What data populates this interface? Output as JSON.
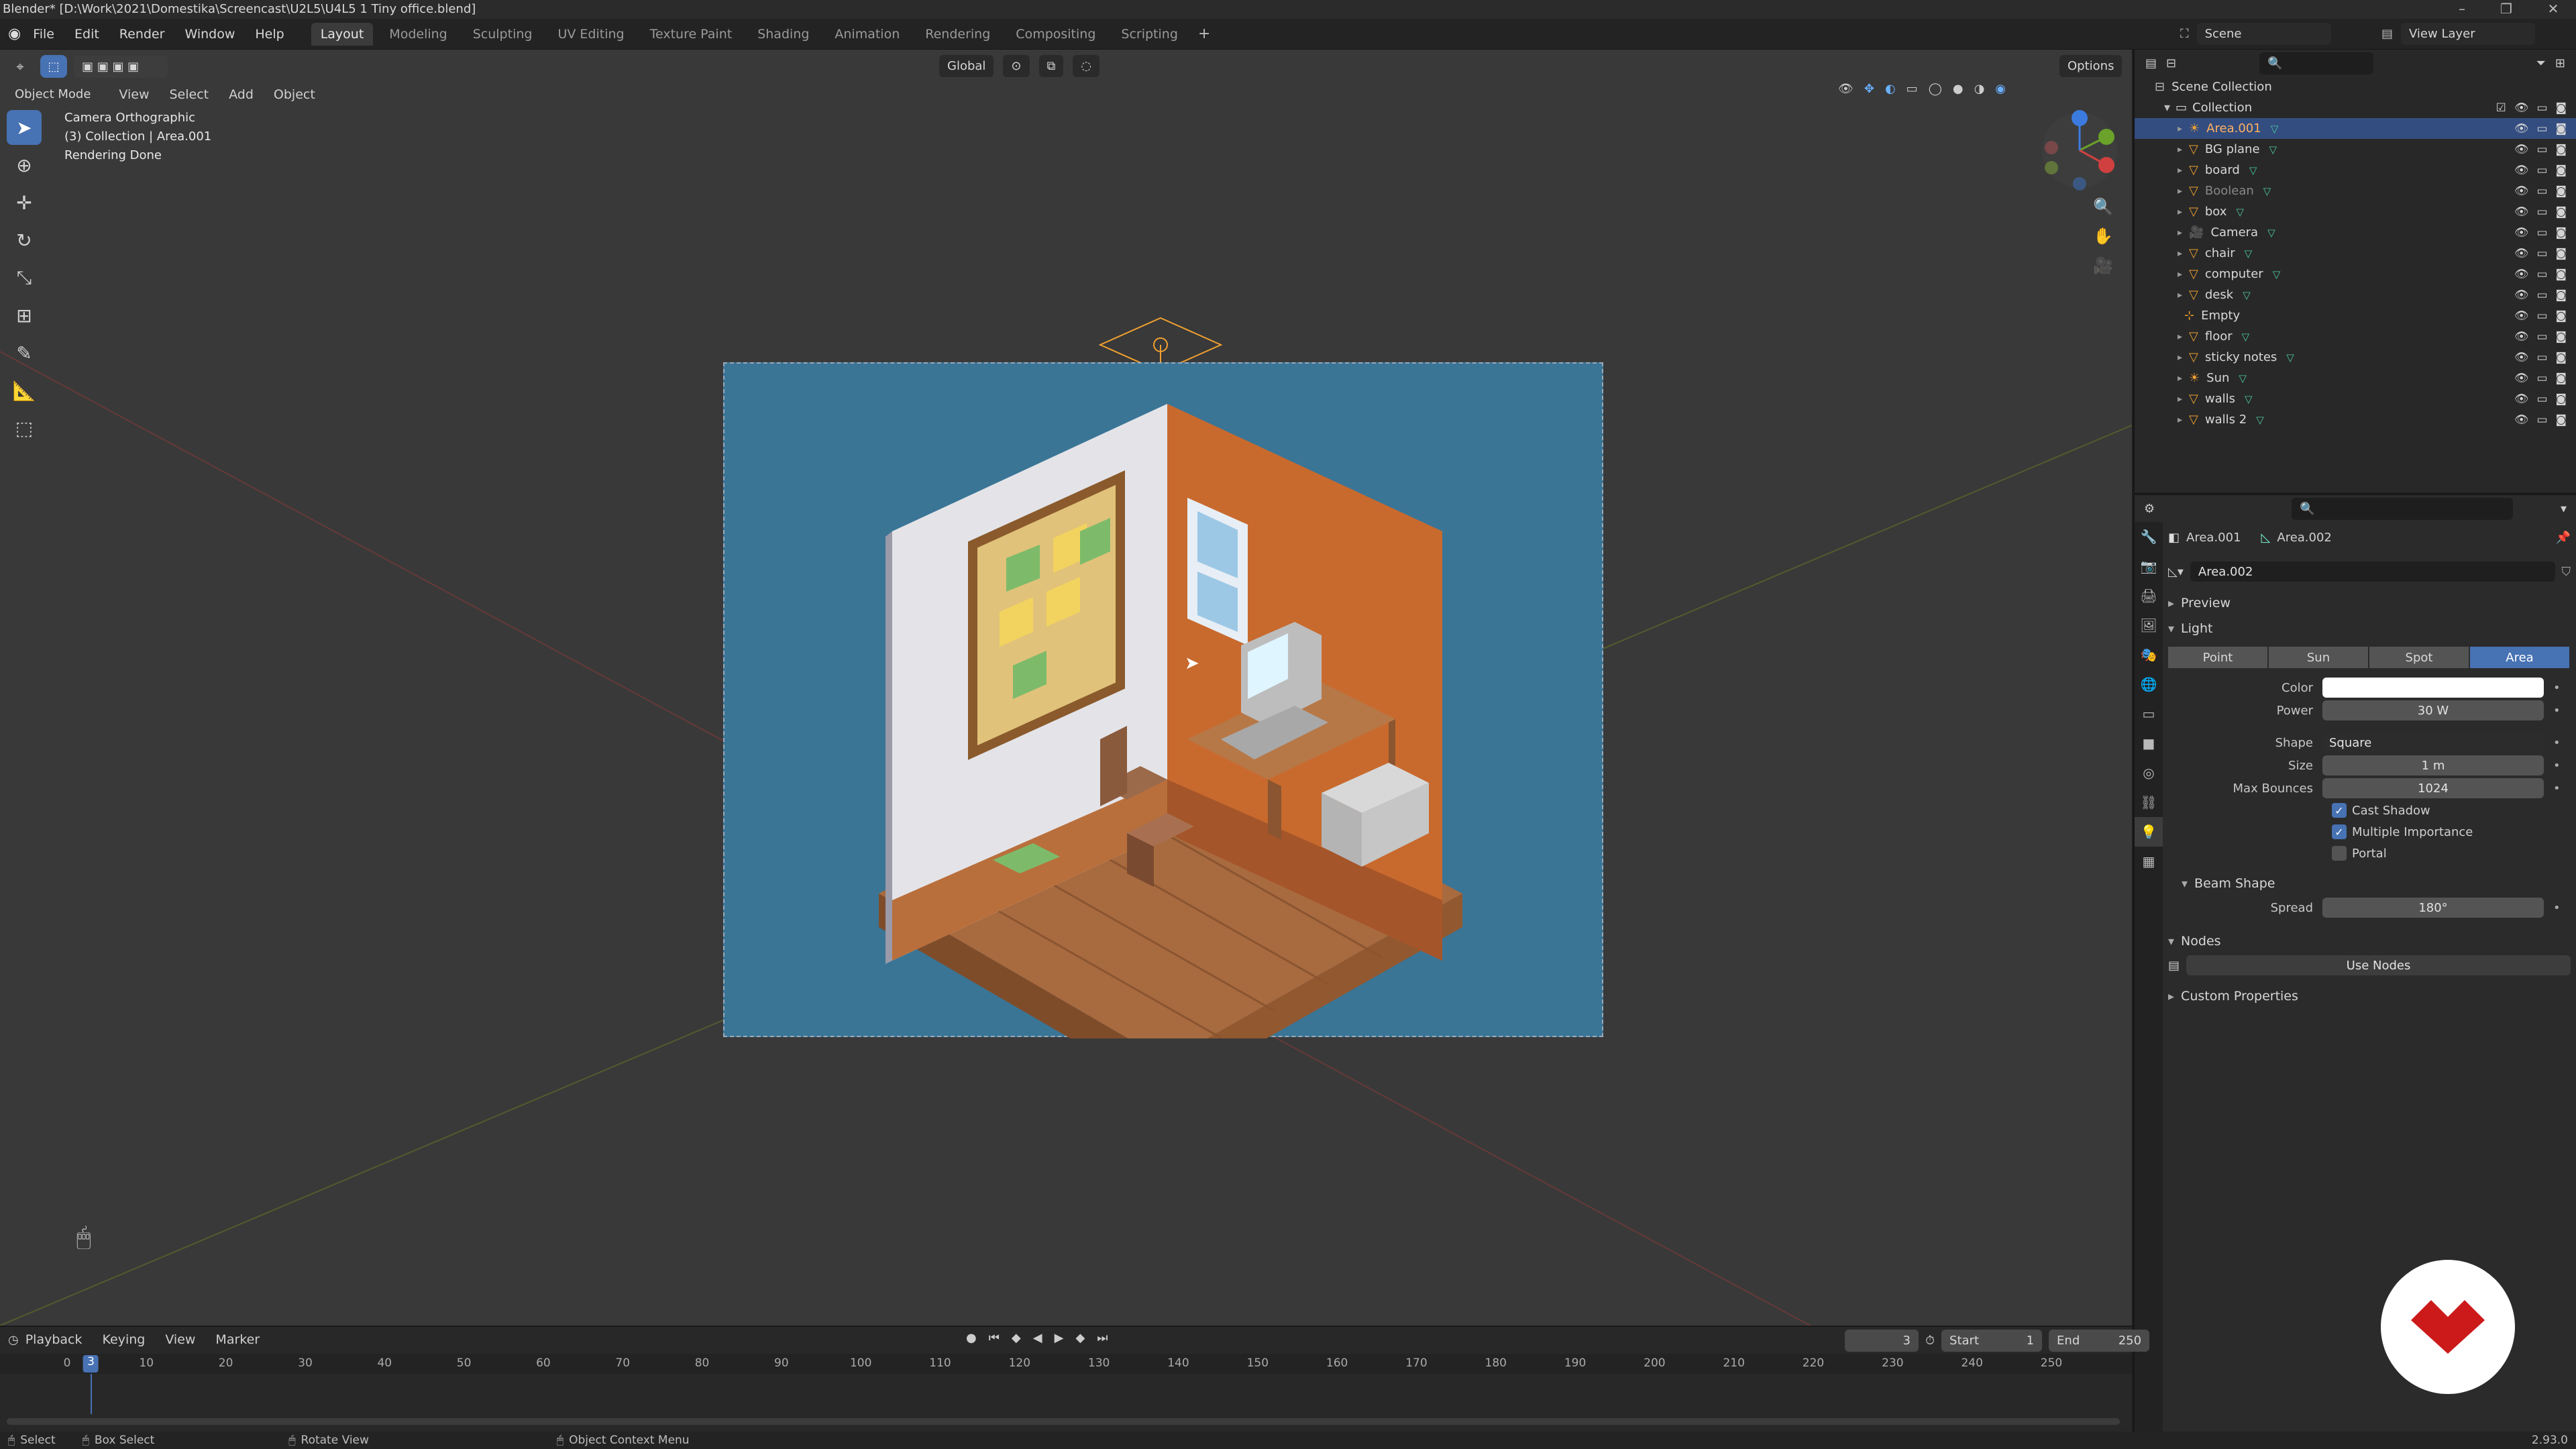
{
  "window": {
    "title": "Blender* [D:\\Work\\2021\\Domestika\\Screencast\\U2L5\\U4L5 1 Tiny office.blend]"
  },
  "menubar": {
    "menus": [
      "File",
      "Edit",
      "Render",
      "Window",
      "Help"
    ],
    "workspaces": [
      "Layout",
      "Modeling",
      "Sculpting",
      "UV Editing",
      "Texture Paint",
      "Shading",
      "Animation",
      "Rendering",
      "Compositing",
      "Scripting"
    ],
    "active_workspace": "Layout",
    "scene_label": "Scene",
    "view_layer_label": "View Layer"
  },
  "viewport": {
    "mode_label": "Object Mode",
    "menus": [
      "View",
      "Select",
      "Add",
      "Object"
    ],
    "transform_orientation": "Global",
    "options_label": "Options",
    "overlay_lines": [
      "Camera Orthographic",
      "(3) Collection | Area.001",
      "Rendering Done"
    ]
  },
  "outliner": {
    "root": "Scene Collection",
    "collection": "Collection",
    "items": [
      {
        "name": "Area.001",
        "selected": true,
        "muted": false
      },
      {
        "name": "BG plane",
        "selected": false,
        "muted": false
      },
      {
        "name": "board",
        "selected": false,
        "muted": false
      },
      {
        "name": "Boolean",
        "selected": false,
        "muted": true
      },
      {
        "name": "box",
        "selected": false,
        "muted": false
      },
      {
        "name": "Camera",
        "selected": false,
        "muted": false
      },
      {
        "name": "chair",
        "selected": false,
        "muted": false
      },
      {
        "name": "computer",
        "selected": false,
        "muted": false
      },
      {
        "name": "desk",
        "selected": false,
        "muted": false
      },
      {
        "name": "Empty",
        "selected": false,
        "muted": false
      },
      {
        "name": "floor",
        "selected": false,
        "muted": false
      },
      {
        "name": "sticky notes",
        "selected": false,
        "muted": false
      },
      {
        "name": "Sun",
        "selected": false,
        "muted": false
      },
      {
        "name": "walls",
        "selected": false,
        "muted": false
      },
      {
        "name": "walls 2",
        "selected": false,
        "muted": false
      }
    ]
  },
  "properties": {
    "breadcrumb_object": "Area.001",
    "breadcrumb_data": "Area.002",
    "datablock_name": "Area.002",
    "preview_label": "Preview",
    "light_label": "Light",
    "light_types": [
      "Point",
      "Sun",
      "Spot",
      "Area"
    ],
    "active_light_type": "Area",
    "color_label": "Color",
    "power_label": "Power",
    "power_value": "30 W",
    "shape_label": "Shape",
    "shape_value": "Square",
    "size_label": "Size",
    "size_value": "1 m",
    "max_bounces_label": "Max Bounces",
    "max_bounces_value": "1024",
    "cast_shadow_label": "Cast Shadow",
    "cast_shadow": true,
    "multiple_importance_label": "Multiple Importance",
    "multiple_importance": true,
    "portal_label": "Portal",
    "portal": false,
    "beam_shape_label": "Beam Shape",
    "spread_label": "Spread",
    "spread_value": "180°",
    "nodes_label": "Nodes",
    "use_nodes_label": "Use Nodes",
    "custom_props_label": "Custom Properties"
  },
  "timeline": {
    "menus": [
      "Playback",
      "Keying",
      "View",
      "Marker"
    ],
    "current_frame": "3",
    "start_label": "Start",
    "start_value": "1",
    "end_label": "End",
    "end_value": "250",
    "ruler_ticks": [
      "0",
      "10",
      "20",
      "30",
      "40",
      "50",
      "60",
      "70",
      "80",
      "90",
      "100",
      "110",
      "120",
      "130",
      "140",
      "150",
      "160",
      "170",
      "180",
      "190",
      "200",
      "210",
      "220",
      "230",
      "240",
      "250"
    ],
    "playhead_label": "3"
  },
  "statusbar": {
    "select": "Select",
    "box_select": "Box Select",
    "rotate_view": "Rotate View",
    "context_menu": "Object Context Menu",
    "version": "2.93.0"
  },
  "colors": {
    "accent": "#4772b3",
    "selection": "#334d80",
    "render_bg": "#3a7596",
    "watermark": "#cc1a1a"
  }
}
